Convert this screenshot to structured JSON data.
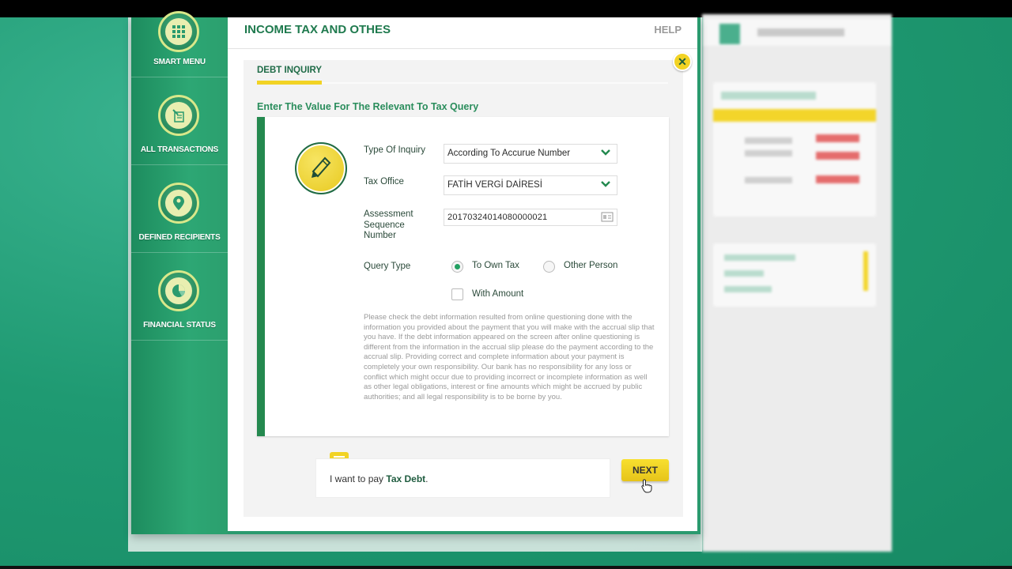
{
  "header": {
    "title": "INCOME TAX AND OTHES",
    "help": "HELP"
  },
  "sidebar": {
    "items": [
      {
        "label": "SMART MENU",
        "icon": "grid-icon"
      },
      {
        "label": "ALL TRANSACTIONS",
        "icon": "transactions-icon"
      },
      {
        "label": "DEFINED RECIPIENTS",
        "icon": "recipient-pin-icon"
      },
      {
        "label": "FINANCIAL STATUS",
        "icon": "pie-chart-icon"
      }
    ]
  },
  "tabs": {
    "active": "DEBT INQUIRY"
  },
  "form": {
    "instruction": "Enter The Value For The Relevant To Tax Query",
    "type_of_inquiry": {
      "label": "Type Of Inquiry",
      "value": "According To Accurue Number"
    },
    "tax_office": {
      "label": "Tax Office",
      "value": "FATİH VERGİ DAİRESİ"
    },
    "assessment": {
      "label": "Assessment Sequence Number",
      "value": "20170324014080000021"
    },
    "query_type": {
      "label": "Query Type",
      "options": [
        {
          "label": "To Own Tax",
          "selected": true
        },
        {
          "label": "Other Person",
          "selected": false
        }
      ]
    },
    "with_amount": {
      "label": "With Amount",
      "checked": false
    },
    "disclaimer": "Please check the debt information resulted from online questioning done with the information you provided about the payment that you will make with the accrual slip that you have. If the debt information appeared on the screen after online questioning is different from the information in the accrual slip please do the payment according to the accrual slip. Providing correct and complete information about your payment is completely your own responsibility. Our bank has no responsibility for any loss or conflict which might occur due to providing incorrect or incomplete information as well as other legal obligations, interest or fine amounts which might be accrued by public authorities; and all legal responsibility is to be borne by you."
  },
  "tip": {
    "prefix": "I want to pay ",
    "bold": "Tax Debt",
    "suffix": "."
  },
  "buttons": {
    "next": "NEXT",
    "close": "✕"
  },
  "colors": {
    "brand_green": "#2a9a6e",
    "accent_yellow": "#f2d324",
    "text_green": "#1f7a4e"
  }
}
